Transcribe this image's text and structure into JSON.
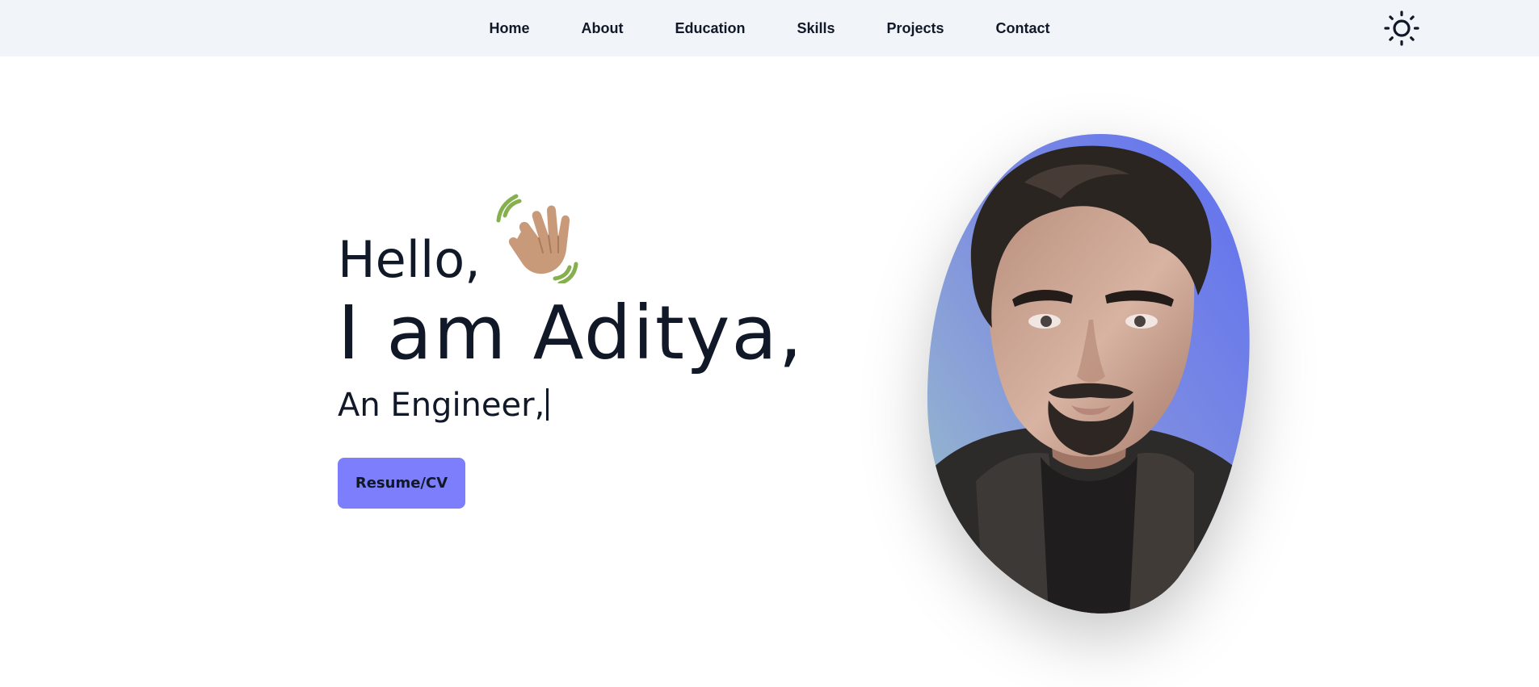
{
  "nav": {
    "links": [
      "Home",
      "About",
      "Education",
      "Skills",
      "Projects",
      "Contact"
    ],
    "theme_icon": "sun-icon"
  },
  "hero": {
    "greeting": "Hello,",
    "wave_icon": "waving-hand-icon",
    "name": "I am Aditya,",
    "role": "An Engineer,",
    "resume_label": "Resume/CV"
  },
  "avatar": {
    "icon": "profile-avatar",
    "colors": {
      "background_top": "#6b77ee",
      "background_bottom": "#8fb3cf",
      "hair": "#2b2522",
      "skin": "#c9a491",
      "beard": "#2e2622",
      "jacket": "#2f2d2c"
    }
  },
  "colors": {
    "nav_bg": "#f1f4f9",
    "accent": "#7c7efb",
    "text": "#111827"
  }
}
